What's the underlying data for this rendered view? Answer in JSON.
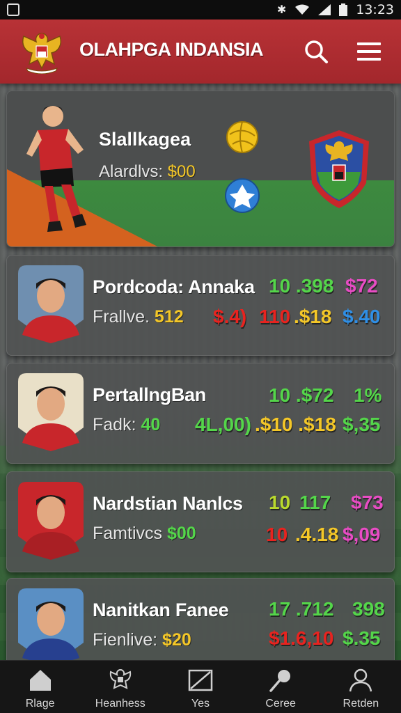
{
  "status_bar": {
    "time": "13:23",
    "icons": [
      "app-icon",
      "bluetooth-icon",
      "wifi-icon",
      "signal-icon",
      "battery-icon"
    ]
  },
  "header": {
    "title": "OLAHPGA INDANSIA",
    "logo": "garuda-emblem-icon",
    "actions": [
      "search-icon",
      "menu-icon"
    ]
  },
  "featured": {
    "name": "Slallkagea",
    "subtitle_label": "Alardlvs:",
    "subtitle_value": "$00",
    "crest": "club-crest-icon"
  },
  "players": [
    {
      "name": "Pordcoda: Annaka",
      "sub_label": "Frallve.",
      "sub_value": "512",
      "stats": [
        {
          "text": "10 .398",
          "color": "#54d64a"
        },
        {
          "text": "$72",
          "color": "#e84cc4"
        },
        {
          "text": "$.4)",
          "color": "#e8231f"
        },
        {
          "text": "110",
          "color": "#e8231f"
        },
        {
          "text": ".$18",
          "color": "#f4c728"
        },
        {
          "text": "$.40",
          "color": "#2f8fe6"
        }
      ]
    },
    {
      "name": "PertallngBan",
      "sub_label": "Fadk:",
      "sub_value": "40",
      "stats": [
        {
          "text": "10 .$72",
          "color": "#54d64a"
        },
        {
          "text": "1%",
          "color": "#54d64a"
        },
        {
          "text": "4L,00)",
          "color": "#54d64a"
        },
        {
          "text": ".$10 .$18",
          "color": "#f4c728"
        },
        {
          "text": "$,35",
          "color": "#54d64a"
        }
      ]
    },
    {
      "name": "Nardstian Nanlcs",
      "sub_label": "Famtivcs",
      "sub_value": "$00",
      "stats": [
        {
          "text": "10",
          "color": "#b9d92d"
        },
        {
          "text": "117",
          "color": "#54d64a"
        },
        {
          "text": "$73",
          "color": "#e84cc4"
        },
        {
          "text": "10",
          "color": "#e8231f"
        },
        {
          "text": ".4.18",
          "color": "#f4c728"
        },
        {
          "text": "$,09",
          "color": "#e84cc4"
        }
      ]
    },
    {
      "name": "Nanitkan Fanee",
      "sub_label": "Fienlive:",
      "sub_value": "$20",
      "stats": [
        {
          "text": "17 .712",
          "color": "#54d64a"
        },
        {
          "text": "398",
          "color": "#54d64a"
        },
        {
          "text": "$1.6,10",
          "color": "#e8231f"
        },
        {
          "text": "$.35",
          "color": "#54d64a"
        }
      ]
    }
  ],
  "bottom_nav": [
    {
      "label": "Rlage",
      "icon": "home-icon"
    },
    {
      "label": "Heanhess",
      "icon": "crest-icon"
    },
    {
      "label": "Yes",
      "icon": "field-icon"
    },
    {
      "label": "Ceree",
      "icon": "racket-icon"
    },
    {
      "label": "Retden",
      "icon": "profile-icon"
    }
  ]
}
